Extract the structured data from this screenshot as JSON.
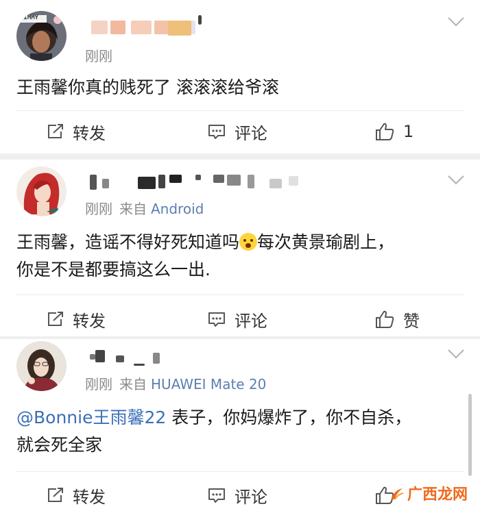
{
  "posts": [
    {
      "avatar_label": "TIMMY",
      "time": "刚刚",
      "source_prefix": "",
      "device": "",
      "content": "王雨馨你真的贱死了 滚滚滚给爷滚",
      "actions": {
        "repost": "转发",
        "comment": "评论",
        "like": "1"
      }
    },
    {
      "time": "刚刚",
      "source_prefix": "来自",
      "device": "Android",
      "content_line1": "王雨馨，造谣不得好死知道吗",
      "content_line1b": "每次黄景瑜剧上，",
      "content_line2": "你是不是都要搞这么一出.",
      "emoji": "scream-emoji",
      "actions": {
        "repost": "转发",
        "comment": "评论",
        "like": "赞"
      }
    },
    {
      "time": "刚刚",
      "source_prefix": "来自",
      "device": "HUAWEI Mate 20",
      "mention": "@Bonnie王雨馨22",
      "content_line1": " 表子，你妈爆炸了，你不自杀，",
      "content_line2": "就会死全家",
      "actions": {
        "repost": "转发",
        "comment": "评论",
        "like": "赞"
      }
    }
  ],
  "watermark": "广西龙网",
  "colors": {
    "link": "#3b6fb6",
    "meta": "#8a8a8a",
    "watermark": "#f06a1c"
  },
  "icons": [
    "repost-icon",
    "comment-icon",
    "like-icon",
    "chevron-down-icon"
  ]
}
